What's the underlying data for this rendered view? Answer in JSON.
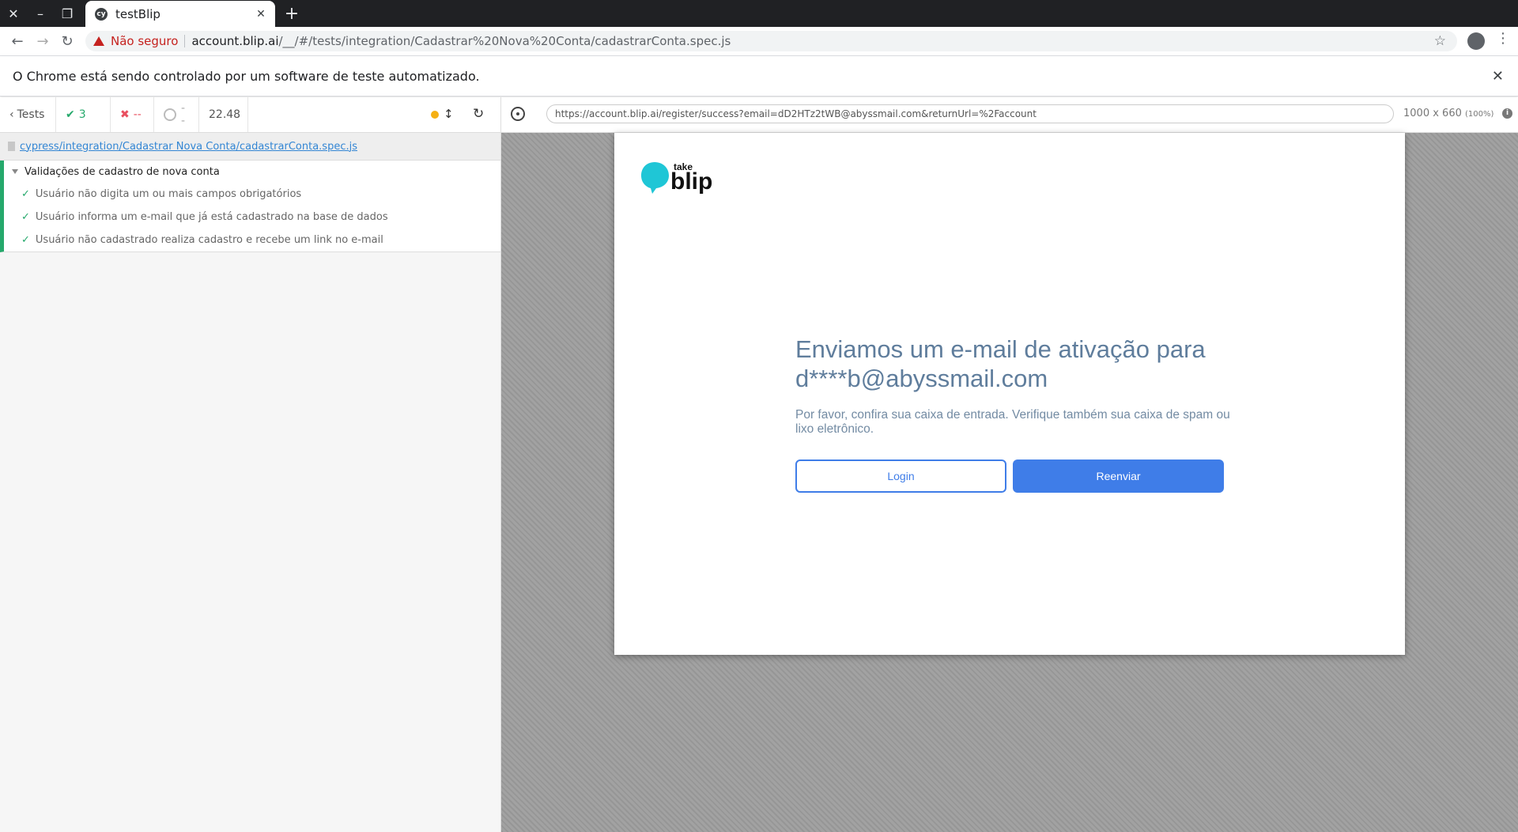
{
  "browser": {
    "tab_title": "testBlip",
    "tab_favicon": "cy",
    "security_label": "Não seguro",
    "url_host": "account.blip.ai",
    "url_path": "/__/#/tests/integration/Cadastrar%20Nova%20Conta/cadastrarConta.spec.js",
    "infobar_message": "O Chrome está sendo controlado por um software de teste automatizado."
  },
  "reporter": {
    "back_label": "Tests",
    "passed_count": "3",
    "failed_count": "--",
    "pending_count": "--",
    "duration": "22.48",
    "spec_path": "cypress/integration/Cadastrar Nova Conta/cadastrarConta.spec.js",
    "suite_title": "Validações de cadastro de nova conta",
    "tests": [
      "Usuário não digita um ou mais campos obrigatórios",
      "Usuário informa um e-mail que já está cadastrado na base de dados",
      "Usuário não cadastrado realiza cadastro e recebe um link no e-mail"
    ]
  },
  "aut": {
    "url": "https://account.blip.ai/register/success?email=dD2HTz2tWB@abyssmail.com&returnUrl=%2Faccount",
    "viewport_size": "1000 x 660",
    "viewport_zoom": "(100%)",
    "logo_small": "take",
    "logo_big": "blip",
    "headline": "Enviamos um e-mail de ativação para d****b@abyssmail.com",
    "subtext": "Por favor, confira sua caixa de entrada. Verifique também sua caixa de spam ou lixo eletrônico.",
    "login_label": "Login",
    "resend_label": "Reenviar"
  },
  "colors": {
    "brand_blue": "#3f7de8",
    "blip_cyan": "#1fc6d6",
    "pass_green": "#26a96c",
    "fail_red": "#e94f5f"
  }
}
